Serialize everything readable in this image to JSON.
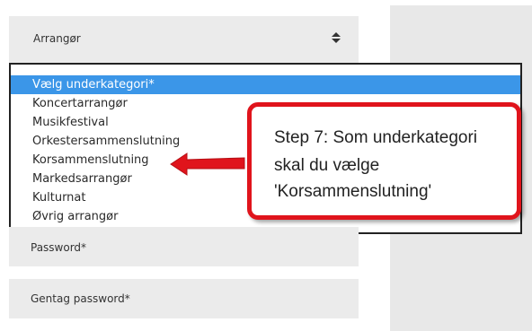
{
  "form": {
    "arrangor_label": "Arrangør",
    "password_label": "Password*",
    "gentag_password_label": "Gentag password*"
  },
  "dropdown": {
    "options": [
      "Vælg underkategori*",
      "Koncertarrangør",
      "Musikfestival",
      "Orkestersammenslutning",
      "Korsammenslutning",
      "Markedsarrangør",
      "Kulturnat",
      "Øvrig arrangør"
    ],
    "selected_index": 0
  },
  "callout": {
    "line1": "Step 7: Som underkategori",
    "line2": "skal du vælge",
    "line3": "'Korsammenslutning'"
  },
  "icons": {
    "sort": "sort-updown-icon",
    "arrow": "red-arrow-left-icon"
  },
  "colors": {
    "selected_option_bg": "#3b96e8",
    "callout_border": "#e0141c",
    "field_bg": "#ebebeb"
  }
}
